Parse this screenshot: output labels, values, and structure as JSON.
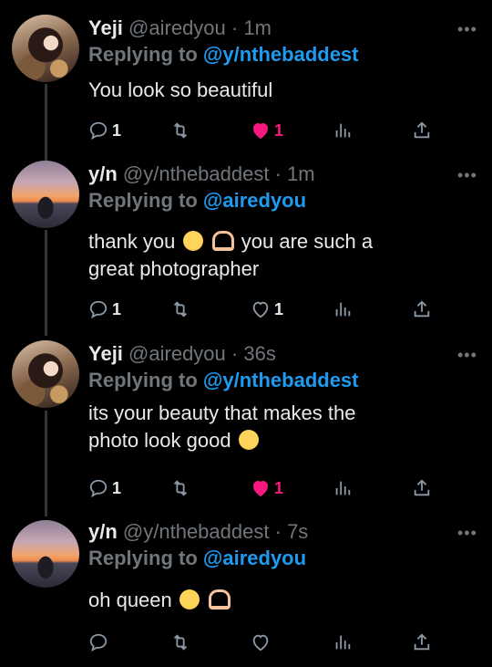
{
  "tweets": [
    {
      "name": "Yeji",
      "handle": "@airedyou",
      "time": "1m",
      "replying_label": "Replying to",
      "replying_to": "@y/nthebaddest",
      "text": "You look so beautiful",
      "replies": "1",
      "likes": "1",
      "liked": true
    },
    {
      "name": "y/n",
      "handle": "@y/nthebaddest",
      "time": "1m",
      "replying_label": "Replying to",
      "replying_to": "@airedyou",
      "text_line1_a": "thank you",
      "text_line1_b": "you are such a",
      "text_line2": "great photographer",
      "replies": "1",
      "likes": "1",
      "liked": false
    },
    {
      "name": "Yeji",
      "handle": "@airedyou",
      "time": "36s",
      "replying_label": "Replying to",
      "replying_to": "@y/nthebaddest",
      "text_line1": "its your beauty that makes the",
      "text_line2": "photo look good",
      "replies": "1",
      "likes": "1",
      "liked": true
    },
    {
      "name": "y/n",
      "handle": "@y/nthebaddest",
      "time": "7s",
      "replying_label": "Replying to",
      "replying_to": "@airedyou",
      "text": "oh queen",
      "replies": "",
      "likes": "",
      "liked": false
    }
  ],
  "separator": "·",
  "more_label": "•••",
  "colors": {
    "background": "#000000",
    "text": "#e7e9ea",
    "muted": "#71767b",
    "mention": "#1d9bf0",
    "like": "#f91880"
  },
  "icons": {
    "reply": "reply-icon",
    "retweet": "retweet-icon",
    "like": "heart-icon",
    "views": "analytics-icon",
    "share": "share-icon",
    "more": "more-icon"
  }
}
